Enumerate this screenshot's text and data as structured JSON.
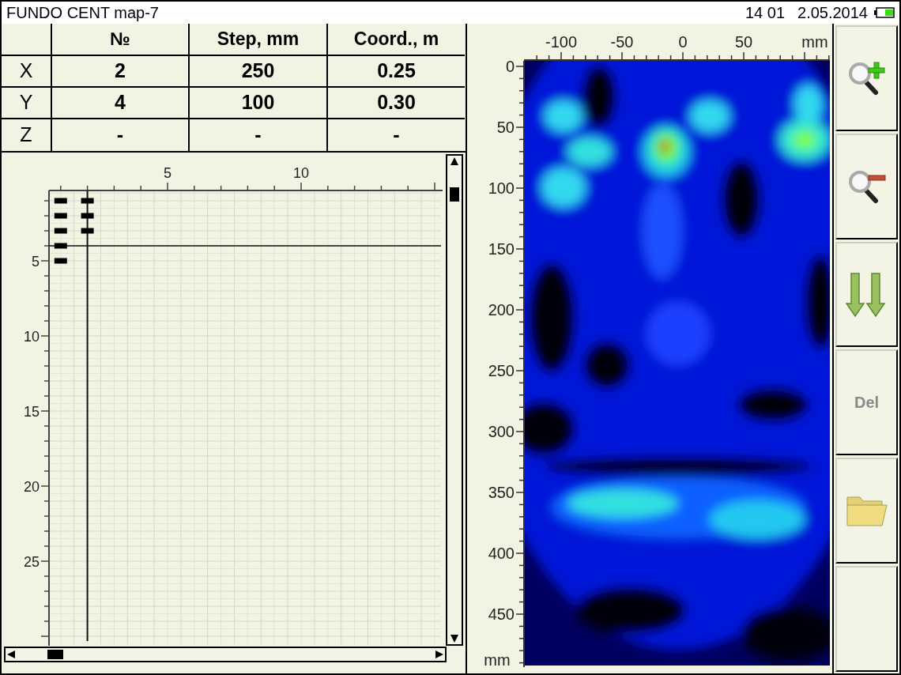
{
  "status_bar": {
    "title": "FUNDO CENT map-7",
    "time": "14 01",
    "date": "2.05.2014"
  },
  "table": {
    "columns": [
      "",
      "№",
      "Step, mm",
      "Coord., m"
    ],
    "rows": [
      {
        "cells": [
          "X",
          "2",
          "250",
          "0.25"
        ]
      },
      {
        "cells": [
          "Y",
          "4",
          "100",
          "0.30"
        ]
      },
      {
        "cells": [
          "Z",
          "-",
          "-",
          "-"
        ]
      }
    ]
  },
  "scan_grid": {
    "x_ticks": [
      "5",
      "10"
    ],
    "y_ticks": [
      "5",
      "10",
      "15",
      "20",
      "25"
    ],
    "columns": [
      {
        "measured": [
          true,
          true,
          true,
          true,
          true
        ]
      },
      {
        "measured": [
          true,
          true,
          true
        ]
      }
    ]
  },
  "heatmap": {
    "x_ticks": [
      "-100",
      "-50",
      "0",
      "50"
    ],
    "x_unit": "mm",
    "y_ticks": [
      "0",
      "50",
      "100",
      "150",
      "200",
      "250",
      "300",
      "350",
      "400",
      "450"
    ],
    "y_unit": "mm"
  },
  "toolbar": [
    {
      "kind": "zoom_in"
    },
    {
      "kind": "zoom_out"
    },
    {
      "kind": "scroll_down"
    },
    {
      "kind": "text",
      "label": "Del",
      "disabled": true
    },
    {
      "kind": "open"
    },
    {
      "kind": "empty"
    }
  ]
}
